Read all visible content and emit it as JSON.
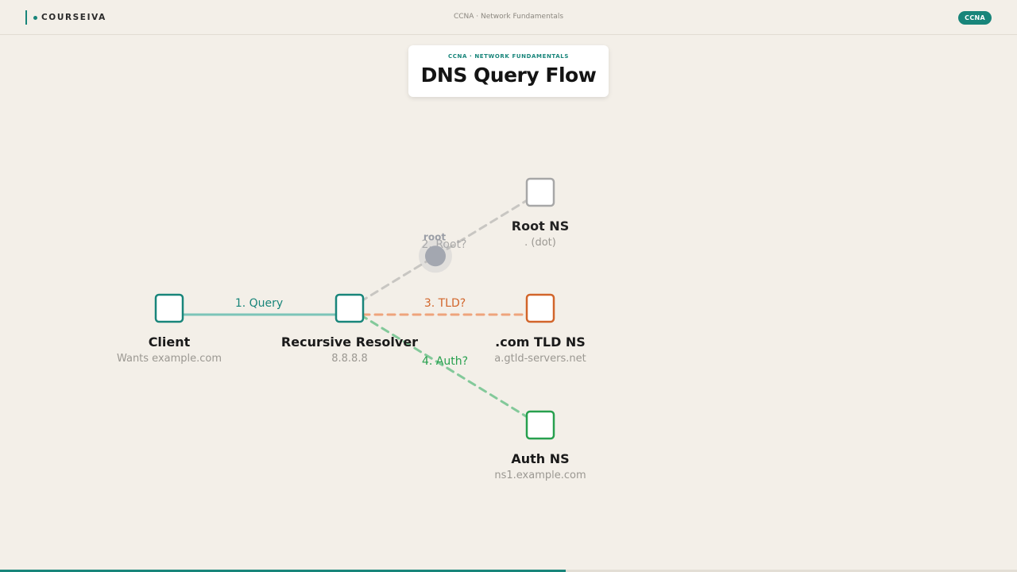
{
  "header": {
    "brand": "COURSEIVA",
    "course": "CCNA · Network Fundamentals",
    "badge": "CCNA"
  },
  "title_card": {
    "kicker": "CCNA · NETWORK FUNDAMENTALS",
    "title": "DNS Query Flow"
  },
  "nodes": [
    {
      "id": "client",
      "name": "Client",
      "detail": "Wants example.com",
      "color": "#18857a",
      "active": true
    },
    {
      "id": "resolver",
      "name": "Recursive Resolver",
      "detail": "8.8.8.8",
      "color": "#18857a",
      "active": true
    },
    {
      "id": "root",
      "name": "Root NS",
      "detail": ". (dot)",
      "color": "#a7a7a7",
      "active": false
    },
    {
      "id": "tld",
      "name": ".com TLD NS",
      "detail": "a.gtld-servers.net",
      "color": "#d2652a",
      "active": true
    },
    {
      "id": "auth",
      "name": "Auth NS",
      "detail": "ns1.example.com",
      "color": "#27a04e",
      "active": true
    }
  ],
  "edges": [
    {
      "from": "client",
      "to": "resolver",
      "label": "1. Query",
      "color": "#18857a",
      "line_color": "#7cc4b8",
      "dashed": false,
      "faded": false
    },
    {
      "from": "resolver",
      "to": "root",
      "label": "2. Root?",
      "color": "#a0a0a0",
      "line_color": "#c8c6c2",
      "dashed": true,
      "faded": true
    },
    {
      "from": "resolver",
      "to": "tld",
      "label": "3. TLD?",
      "color": "#d2652a",
      "line_color": "#eea47c",
      "dashed": true,
      "faded": false
    },
    {
      "from": "resolver",
      "to": "auth",
      "label": "4. Auth?",
      "color": "#27a04e",
      "line_color": "#83c99a",
      "dashed": true,
      "faded": false
    }
  ],
  "packet": {
    "label": "root",
    "color": "#a3a7b0",
    "edge": "resolver-root",
    "progress": 0.45
  },
  "progress": {
    "value": 0.556,
    "color": "#18857a"
  }
}
